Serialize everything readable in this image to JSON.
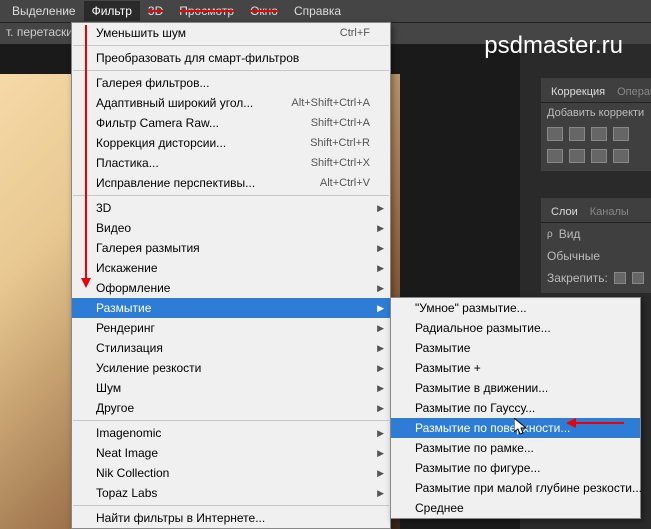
{
  "watermark": "psdmaster.ru",
  "menubar": {
    "items": [
      "Выделение",
      "Фильтр",
      "3D",
      "Просмотр",
      "Окно",
      "Справка"
    ]
  },
  "toolbar": {
    "text": "т. перетаскива"
  },
  "main_menu": {
    "recent": {
      "label": "Уменьшить шум",
      "shortcut": "Ctrl+F"
    },
    "smart": "Преобразовать для смарт-фильтров",
    "group1": [
      {
        "label": "Галерея фильтров..."
      },
      {
        "label": "Адаптивный широкий угол...",
        "shortcut": "Alt+Shift+Ctrl+A"
      },
      {
        "label": "Фильтр Camera Raw...",
        "shortcut": "Shift+Ctrl+A"
      },
      {
        "label": "Коррекция дисторсии...",
        "shortcut": "Shift+Ctrl+R"
      },
      {
        "label": "Пластика...",
        "shortcut": "Shift+Ctrl+X"
      },
      {
        "label": "Исправление перспективы...",
        "shortcut": "Alt+Ctrl+V"
      }
    ],
    "group2": [
      "3D",
      "Видео",
      "Галерея размытия",
      "Искажение",
      "Оформление",
      "Размытие",
      "Рендеринг",
      "Стилизация",
      "Усиление резкости",
      "Шум",
      "Другое"
    ],
    "group3": [
      "Imagenomic",
      "Neat Image",
      "Nik Collection",
      "Topaz Labs"
    ],
    "browse": "Найти фильтры в Интернете..."
  },
  "submenu": {
    "items": [
      "\"Умное\" размытие...",
      "Радиальное размытие...",
      "Размытие",
      "Размытие +",
      "Размытие в движении...",
      "Размытие по Гауссу...",
      "Размытие по поверхности...",
      "Размытие по рамке...",
      "Размытие по фигуре...",
      "Размытие при малой глубине резкости...",
      "Среднее"
    ]
  },
  "right_panel": {
    "tabs1": [
      "Коррекция",
      "Операции"
    ],
    "add_corr": "Добавить корректи",
    "tabs2": [
      "Слои",
      "Каналы"
    ],
    "kind": "Вид",
    "blend": "Обычные",
    "lock": "Закрепить:"
  }
}
